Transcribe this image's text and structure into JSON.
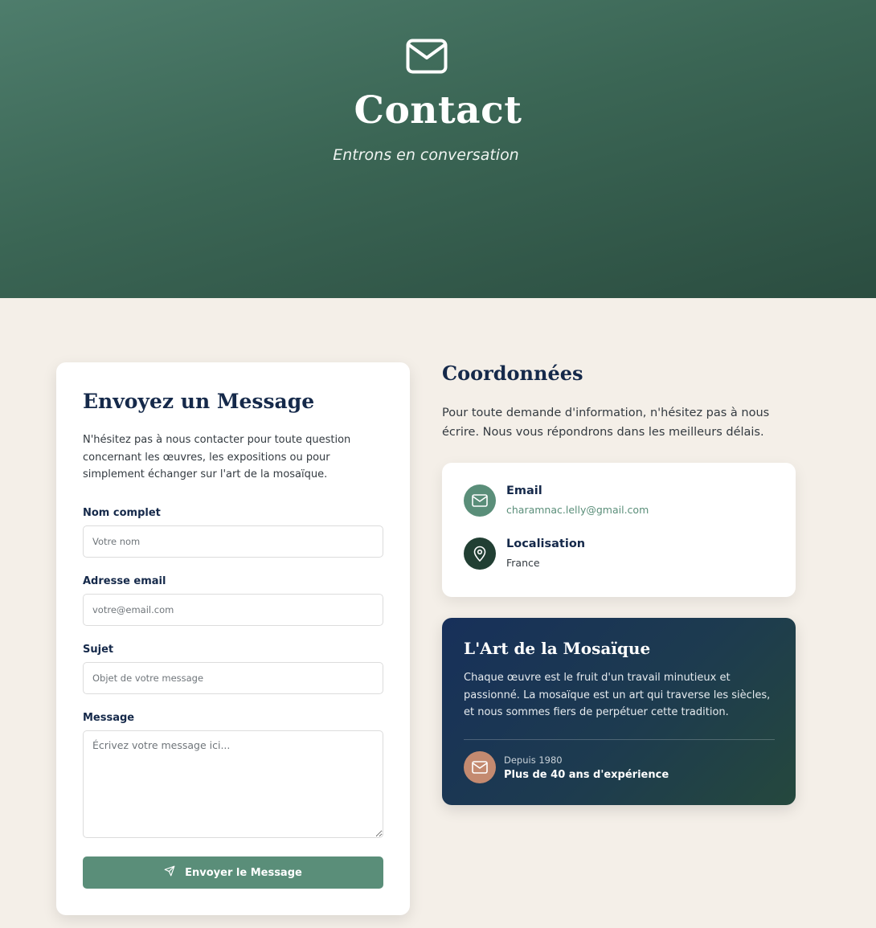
{
  "hero": {
    "title": "Contact",
    "subtitle": "Entrons en conversation",
    "icon": "mail-icon"
  },
  "form": {
    "title": "Envoyez un Message",
    "intro": "N'hésitez pas à nous contacter pour toute question concernant les œuvres, les expositions ou pour simplement échanger sur l'art de la mosaïque.",
    "fields": {
      "name": {
        "label": "Nom complet",
        "placeholder": "Votre nom",
        "value": ""
      },
      "email": {
        "label": "Adresse email",
        "placeholder": "votre@email.com",
        "value": ""
      },
      "subject": {
        "label": "Sujet",
        "placeholder": "Objet de votre message",
        "value": ""
      },
      "message": {
        "label": "Message",
        "placeholder": "Écrivez votre message ici...",
        "value": ""
      }
    },
    "submit_label": "Envoyer le Message",
    "submit_icon": "send-icon"
  },
  "coordinates": {
    "title": "Coordonnées",
    "text": "Pour toute demande d'information, n'hésitez pas à nous écrire. Nous vous répondrons dans les meilleurs délais.",
    "email": {
      "label": "Email",
      "value": "charamnac.lelly@gmail.com",
      "icon": "mail-icon"
    },
    "location": {
      "label": "Localisation",
      "value": "France",
      "icon": "map-pin-icon"
    }
  },
  "art": {
    "title": "L'Art de la Mosaïque",
    "text": "Chaque œuvre est le fruit d'un travail minutieux et passionné. La mosaïque est un art qui traverse les siècles, et nous sommes fiers de perpétuer cette tradition.",
    "since": "Depuis 1980",
    "experience": "Plus de 40 ans d'expérience",
    "icon": "mail-icon"
  },
  "colors": {
    "hero_gradient_start": "#4e7d6c",
    "hero_gradient_end": "#2b4d40",
    "page_background": "#f4efe8",
    "heading_navy": "#15294a",
    "accent_green": "#5a8e79",
    "dark_green": "#213f33",
    "terracotta": "#c48a70",
    "email_link": "#5a8e79"
  }
}
